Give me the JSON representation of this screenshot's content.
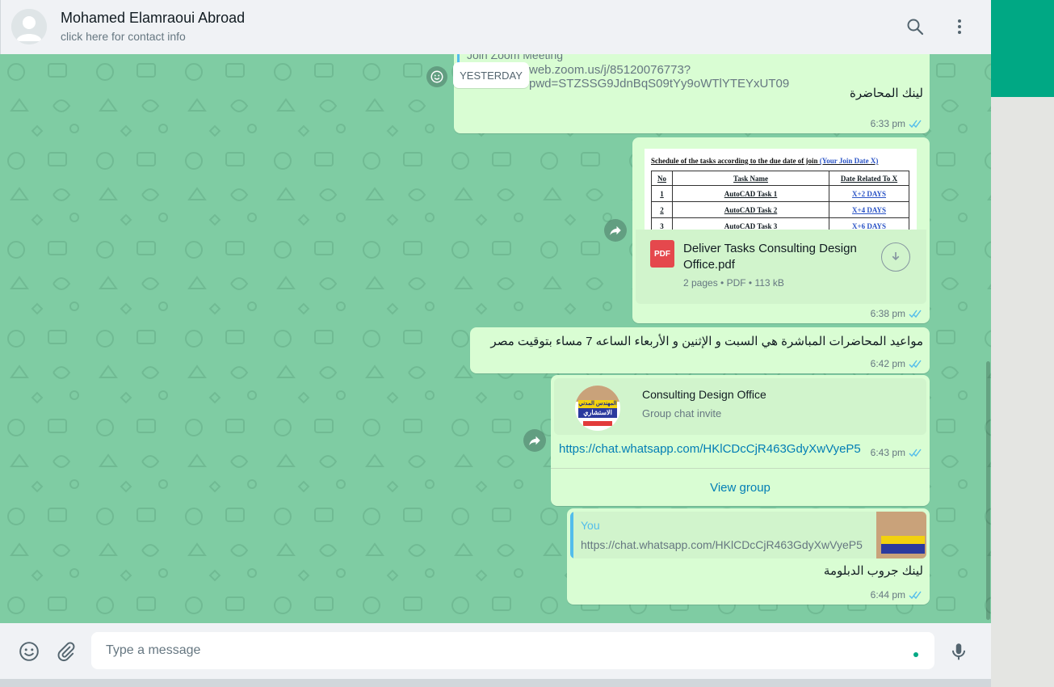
{
  "header": {
    "contact_name": "Mohamed Elamraoui Abroad",
    "contact_sub": "click here for contact info",
    "icons": [
      "search-icon",
      "menu-icon"
    ]
  },
  "chat": {
    "date_chip": "YESTERDAY",
    "messages": [
      {
        "type": "link",
        "quoted_title": "Join Zoom Meeting",
        "link": "web.zoom.us/j/85120076773?pwd=STZSSG9JdnBqS09tYy9oWTlYTEYxUT09",
        "text": "لينك المحاضرة",
        "time": "6:33 pm"
      },
      {
        "type": "document",
        "preview": {
          "heading": "Schedule of the tasks according to the due date of join",
          "heading_note": "(Your Join Date  X)",
          "columns": [
            "No",
            "Task Name",
            "Date Related To X"
          ],
          "rows": [
            [
              "1",
              "AutoCAD Task 1",
              "X+2 DAYS"
            ],
            [
              "2",
              "AutoCAD Task 2",
              "X+4 DAYS"
            ],
            [
              "3",
              "AutoCAD Task 3",
              "X+6 DAYS"
            ]
          ]
        },
        "file_badge": "PDF",
        "file_name_line1": "Deliver Tasks Consulting Design",
        "file_name_line2": "Office.pdf",
        "file_info": "2 pages • PDF • 113 kB",
        "time": "6:38 pm"
      },
      {
        "type": "text",
        "text": "مواعيد المحاضرات المباشرة هي السبت  و الإثنين و الأربعاء  الساعه 7 مساء بتوقيت مصر",
        "time": "6:42 pm"
      },
      {
        "type": "invite",
        "group_name": "Consulting Design Office",
        "invite_label": "Group chat invite",
        "link": "https://chat.whatsapp.com/HKlCDcCjR463GdyXwVyeP5",
        "action": "View group",
        "time": "6:43 pm",
        "logo_text_top": "المهندس المدني",
        "logo_text_bottom": "الاستشاري"
      },
      {
        "type": "reply",
        "quoted_author": "You",
        "quoted_text": "https://chat.whatsapp.com/HKlCDcCjR463GdyXwVyeP5",
        "text": "لينك جروب الدبلومة",
        "time": "6:44 pm"
      }
    ]
  },
  "footer": {
    "placeholder": "Type a message",
    "icons": [
      "emoji-icon",
      "attach-icon",
      "mic-icon"
    ]
  },
  "colors": {
    "accent": "#00a884",
    "chat_bg": "#7fcca3",
    "bubble_out": "#d9fdd3",
    "tick_blue": "#53bdeb"
  }
}
